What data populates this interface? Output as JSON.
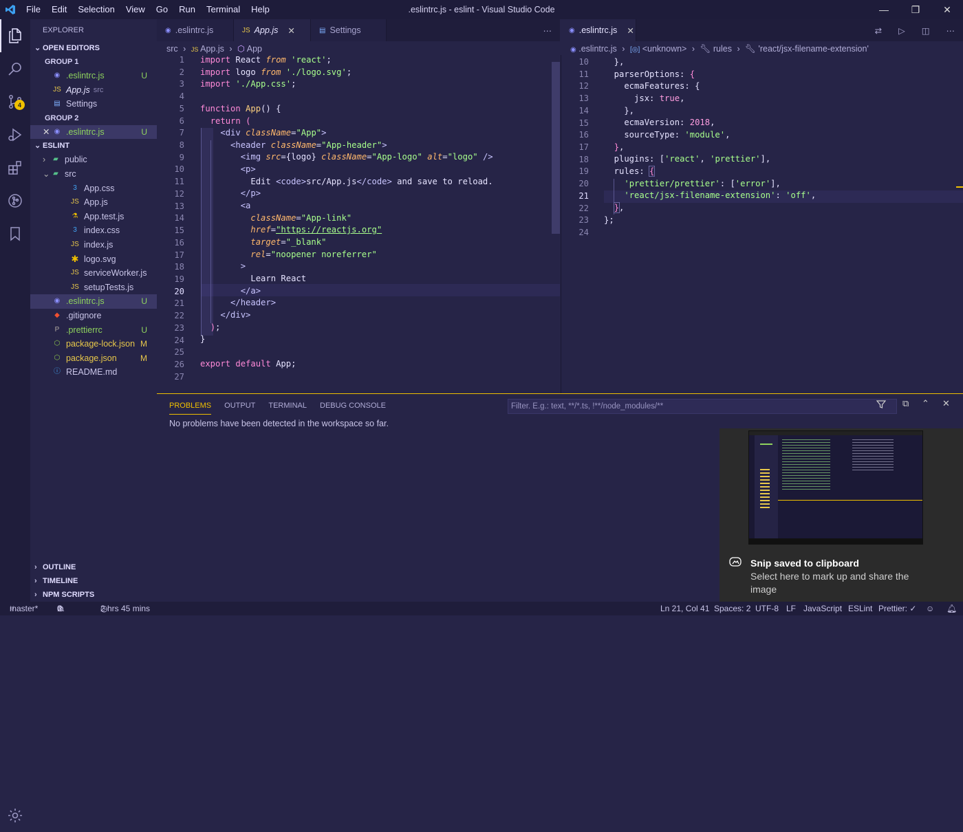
{
  "window": {
    "title": ".eslintrc.js - eslint - Visual Studio Code",
    "menu": [
      "File",
      "Edit",
      "Selection",
      "View",
      "Go",
      "Run",
      "Terminal",
      "Help"
    ],
    "controls": [
      "—",
      "❐",
      "✕"
    ]
  },
  "activity": {
    "items": [
      "files-icon",
      "search-icon",
      "source-control-icon",
      "run-debug-icon",
      "extensions-icon",
      "git-graph-icon",
      "bookmarks-icon",
      "settings-gear-icon"
    ],
    "scm_badge": "4"
  },
  "sidebar": {
    "title": "EXPLORER",
    "open_editors_label": "OPEN EDITORS",
    "group1_label": "GROUP 1",
    "group1": [
      {
        "name": ".eslintrc.js",
        "status": "U"
      },
      {
        "name": "App.js",
        "hint": "src"
      },
      {
        "name": "Settings"
      }
    ],
    "group2_label": "GROUP 2",
    "group2": [
      {
        "name": ".eslintrc.js",
        "status": "U"
      }
    ],
    "project_label": "ESLINT",
    "tree": [
      {
        "name": "public"
      },
      {
        "name": "src"
      },
      {
        "name": "App.css"
      },
      {
        "name": "App.js"
      },
      {
        "name": "App.test.js"
      },
      {
        "name": "index.css"
      },
      {
        "name": "index.js"
      },
      {
        "name": "logo.svg"
      },
      {
        "name": "serviceWorker.js"
      },
      {
        "name": "setupTests.js"
      },
      {
        "name": ".eslintrc.js",
        "status": "U"
      },
      {
        "name": ".gitignore"
      },
      {
        "name": ".prettierrc",
        "status": "U"
      },
      {
        "name": "package-lock.json",
        "status": "M"
      },
      {
        "name": "package.json",
        "status": "M"
      },
      {
        "name": "README.md"
      }
    ],
    "bottom_sections": [
      "OUTLINE",
      "TIMELINE",
      "NPM SCRIPTS"
    ]
  },
  "editor1": {
    "tabs": [
      ".eslintrc.js",
      "App.js",
      "Settings"
    ],
    "breadcrumb": [
      "src",
      "App.js",
      "App"
    ],
    "line_numbers": [
      "1",
      "2",
      "3",
      "4",
      "5",
      "6",
      "7",
      "8",
      "9",
      "10",
      "11",
      "12",
      "13",
      "14",
      "15",
      "16",
      "17",
      "18",
      "19",
      "20",
      "21",
      "22",
      "23",
      "24",
      "25",
      "26",
      "27"
    ]
  },
  "editor2": {
    "tab": ".eslintrc.js",
    "breadcrumb": [
      ".eslintrc.js",
      "<unknown>",
      "rules",
      "'react/jsx-filename-extension'"
    ],
    "line_numbers": [
      "10",
      "11",
      "12",
      "13",
      "14",
      "15",
      "16",
      "17",
      "18",
      "19",
      "20",
      "21",
      "22",
      "23",
      "24"
    ]
  },
  "panel": {
    "tabs": [
      "PROBLEMS",
      "OUTPUT",
      "TERMINAL",
      "DEBUG CONSOLE"
    ],
    "filter_placeholder": "Filter. E.g.: text, **/*.ts, !**/node_modules/**",
    "message": "No problems have been detected in the workspace so far."
  },
  "toast": {
    "title": "Snip saved to clipboard",
    "body": "Select here to mark up and share the image"
  },
  "status": {
    "branch": "master*",
    "errors": "0",
    "warnings": "0",
    "time": "2 hrs 45 mins",
    "position": "Ln 21, Col 41",
    "spaces": "Spaces: 2",
    "encoding": "UTF-8",
    "eol": "LF",
    "language": "JavaScript",
    "eslint": "ESLint",
    "prettier": "Prettier: ✓"
  },
  "colors": {
    "accent": "#f0c000",
    "background": "#262447",
    "activity": "#1f1d3b"
  }
}
